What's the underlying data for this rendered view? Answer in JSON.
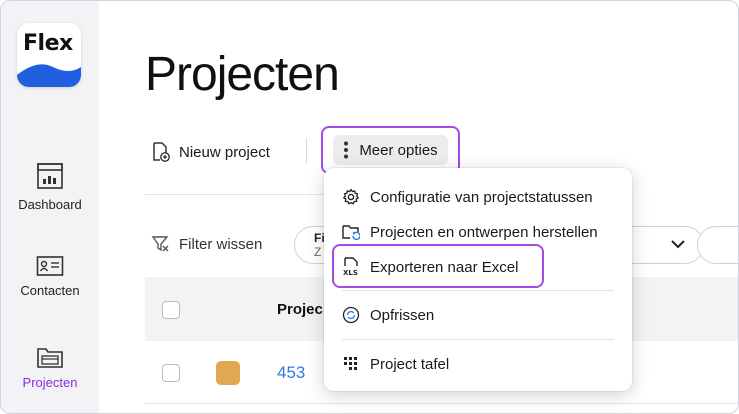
{
  "app": {
    "logo_text": "Flex"
  },
  "sidebar": {
    "items": [
      {
        "label": "Dashboard",
        "icon": "dashboard-icon",
        "active": false
      },
      {
        "label": "Contacten",
        "icon": "contact-card-icon",
        "active": false
      },
      {
        "label": "Projecten",
        "icon": "folder-icon",
        "active": true
      }
    ]
  },
  "page": {
    "title": "Projecten"
  },
  "toolbar": {
    "new_project_label": "Nieuw project",
    "more_options_label": "Meer opties"
  },
  "filter": {
    "clear_label": "Filter wissen",
    "field_label": "Fi",
    "field_value": "Z"
  },
  "table": {
    "column_header": "Projec",
    "rows": [
      {
        "id": "453",
        "color": "#e0a951"
      }
    ]
  },
  "dropdown": {
    "items": [
      {
        "label": "Configuratie van projectstatussen",
        "icon": "gear-icon"
      },
      {
        "label": "Projecten en ontwerpen herstellen",
        "icon": "folder-restore-icon"
      },
      {
        "label": "Exporteren naar Excel",
        "icon": "xls-file-icon"
      },
      {
        "label": "Opfrissen",
        "icon": "refresh-icon"
      },
      {
        "label": "Project tafel",
        "icon": "grid-icon"
      }
    ]
  },
  "colors": {
    "accent": "#8a2be2",
    "highlight_border": "#a24be8",
    "link": "#2f7ae5",
    "logo_blue": "#1f5fe0"
  }
}
